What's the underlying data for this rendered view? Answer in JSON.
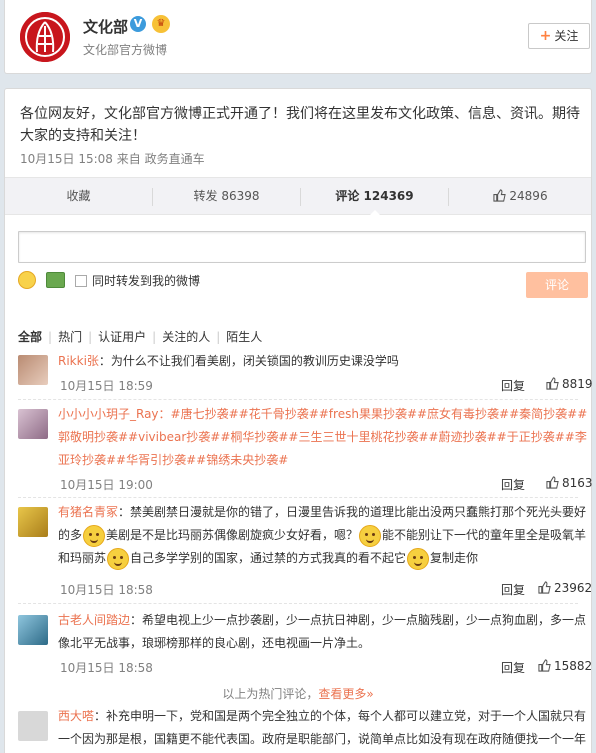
{
  "profile": {
    "name": "文化部",
    "subtitle": "文化部官方微博",
    "follow_label": "关注"
  },
  "post": {
    "text": "各位网友好，文化部官方微博正式开通了！我们将在这里发布文化政策、信息、资讯。期待大家的支持和关注！",
    "meta": "10月15日 15:08 来自 政务直通车"
  },
  "actions": {
    "favorite": "收藏",
    "repost": "转发 86398",
    "comment": "评论 124369",
    "like": "24896"
  },
  "reply": {
    "repost_label": "同时转发到我的微博",
    "submit_label": "评论"
  },
  "tabs": [
    "全部",
    "热门",
    "认证用户",
    "关注的人",
    "陌生人"
  ],
  "comments": [
    {
      "user": "Rikki张",
      "parts": [
        "：为什么不让我们看美剧，闭关锁国的教训历史课没学吗"
      ],
      "time": "10月15日 18:59",
      "reply": "回复",
      "likes": "8819"
    },
    {
      "user": "小小小小玥子_Ray",
      "parts": [
        "：#唐七抄袭##花千骨抄袭##fresh果果抄袭##庶女有毒抄袭##秦简抄袭##郭敬明抄袭##vivibear抄袭##桐华抄袭##三生三世十里桃花抄袭##蔚迹抄袭##于正抄袭##李亚玲抄袭##华胥引抄袭##锦绣未央抄袭#"
      ],
      "time": "10月15日 19:00",
      "reply": "回复",
      "likes": "8163"
    },
    {
      "user": "有猪名青冢",
      "parts": [
        "：禁美剧禁日漫就是你的错了，日漫里告诉我的道理比能出没两只蠢熊打那个死光头要好的多",
        "美剧是不是比玛丽苏偶像剧旋疯少女好看，嗯？",
        "能不能别让下一代的童年里全是吸氧羊和玛丽苏",
        "自己多学学别的国家，通过禁的方式我真的看不起它",
        "复制走你"
      ],
      "time": "10月15日 18:58",
      "reply": "回复",
      "likes": "23962"
    },
    {
      "user": "古老人间踏边",
      "parts": [
        "：希望电视上少一点抄袭剧，少一点抗日神剧，少一点脑残剧，少一点狗血剧，多一点像北平无战事，琅琊榜那样的良心剧，还电视画一片净土。"
      ],
      "time": "10月15日 18:58",
      "reply": "回复",
      "likes": "15882"
    },
    {
      "user": "西大嗒",
      "parts": [
        "：补充申明一下，党和国是两个完全独立的个体，每个人都可以建立党，对于一个人国就只有一个因为那是根，国籍更不能代表国。政府是职能部门，说简单点比如没有现在政府随便找一个一年"
      ]
    }
  ],
  "hot_note": {
    "text": "以上为热门评论，",
    "more": "查看更多»"
  },
  "colors": {
    "accent": "#eb7350",
    "follow_plus": "#ff8140",
    "logo_red": "#c8161d",
    "submit_disabled": "#ffc09f"
  }
}
